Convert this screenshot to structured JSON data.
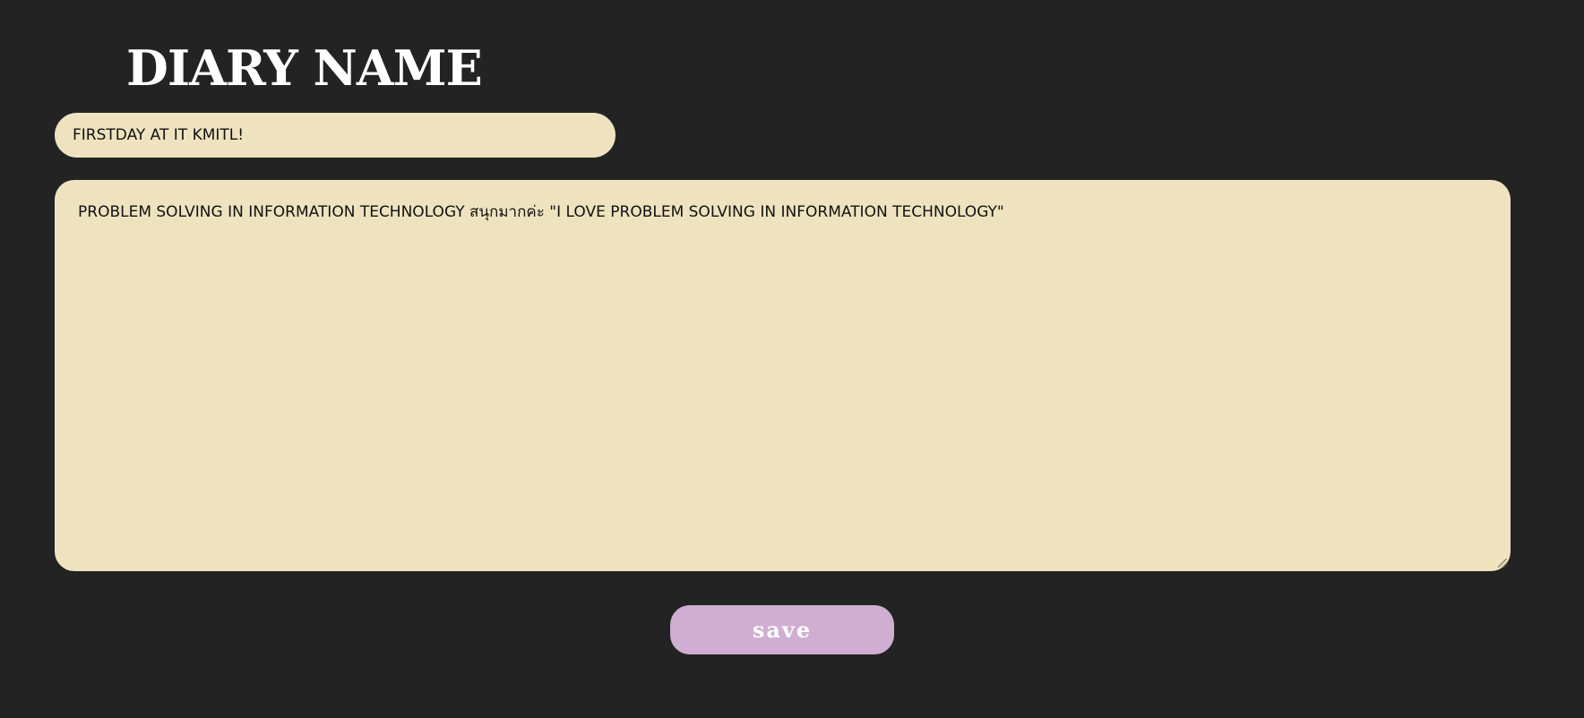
{
  "header": {
    "title": "DIARY NAME"
  },
  "diary": {
    "name_value": "FIRSTDAY AT IT KMITL!",
    "content_value": "PROBLEM SOLVING IN INFORMATION TECHNOLOGY สนุกมากค่ะ \"I LOVE PROBLEM SOLVING IN INFORMATION TECHNOLOGY\""
  },
  "actions": {
    "save_label": "save"
  },
  "colors": {
    "background": "#232323",
    "field": "#efe3bf",
    "button": "#cfaed2"
  }
}
